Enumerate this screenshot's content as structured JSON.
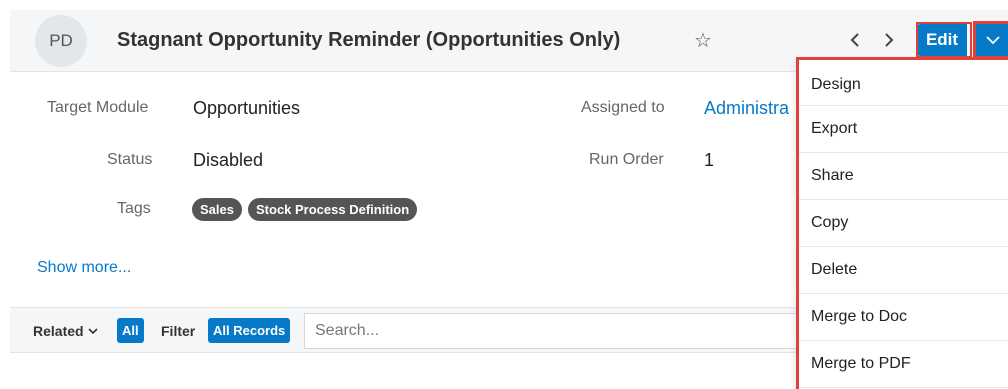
{
  "header": {
    "avatar_initials": "PD",
    "title": "Stagnant Opportunity Reminder (Opportunities Only)",
    "star_icon": "star-icon",
    "edit_label": "Edit"
  },
  "fields": {
    "target_module": {
      "label": "Target Module",
      "value": "Opportunities"
    },
    "status": {
      "label": "Status",
      "value": "Disabled"
    },
    "tags": {
      "label": "Tags",
      "values": [
        "Sales",
        "Stock Process Definition"
      ]
    },
    "assigned_to": {
      "label": "Assigned to",
      "value": "Administra"
    },
    "run_order": {
      "label": "Run Order",
      "value": "1"
    }
  },
  "show_more": "Show more...",
  "subpanel": {
    "related_label": "Related",
    "all_label": "All",
    "filter_label": "Filter",
    "all_records_label": "All Records",
    "search_placeholder": "Search..."
  },
  "actions_menu": {
    "items": [
      "Design",
      "Export",
      "Share",
      "Copy",
      "Delete",
      "Merge to Doc",
      "Merge to PDF"
    ]
  },
  "colors": {
    "accent": "#0679c8",
    "highlight": "#e0413a",
    "tag_background": "#555555"
  }
}
